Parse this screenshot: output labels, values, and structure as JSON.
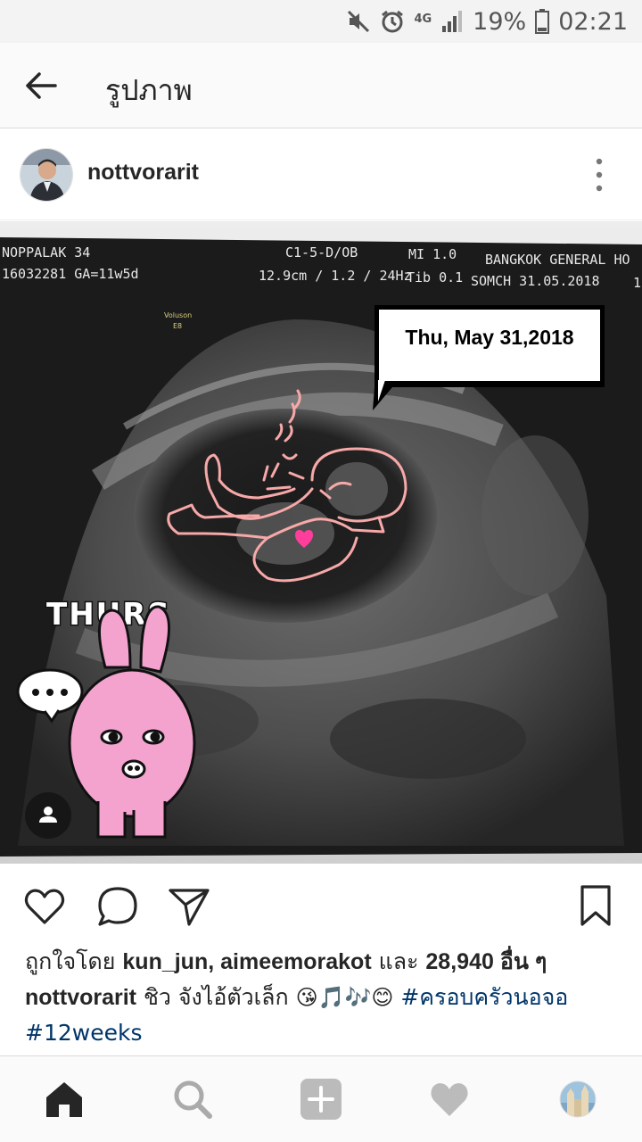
{
  "status_bar": {
    "network": "4G",
    "battery": "19%",
    "time": "02:21"
  },
  "app_bar": {
    "title": "รูปภาพ",
    "back_icon": "arrow-left-icon"
  },
  "post": {
    "username": "nottvorarit",
    "avatar_icon": "profile-avatar",
    "more_icon": "vertical-dots-icon"
  },
  "photo": {
    "header_left_1": "NOPPALAK 34",
    "header_left_2": "16032281 GA=11w5d",
    "header_mid_1": "C1-5-D/OB",
    "header_mid_2": "12.9cm / 1.2 / 24Hz",
    "header_mi_1": "MI 1.0",
    "header_mi_2": "Tib 0.1",
    "header_right_1": "BANGKOK GENERAL HO",
    "header_right_2": "SOMCH 31.05.2018",
    "header_edge": "1",
    "device_label_1": "Voluson",
    "device_label_2": "E8",
    "date_bubble": "Thu, May 31,2018",
    "sticker_text": "THURS",
    "tag_icon": "person-tag-icon"
  },
  "actions": {
    "like_icon": "heart-icon",
    "comment_icon": "comment-icon",
    "share_icon": "send-icon",
    "save_icon": "bookmark-icon"
  },
  "likes": {
    "prefix": "ถูกใจโดย ",
    "users": "kun_jun, aimeemorakot",
    "conj": " และ ",
    "count": "28,940",
    "suffix": " อื่น ๆ"
  },
  "caption": {
    "username": "nottvorarit",
    "text": " ชิว จังไอ้ตัวเล็ก ",
    "emoji": "😘🎵🎶😊",
    "hashtag1": "#ครอบครัวนอจอ",
    "hashtag2": "#12weeks"
  },
  "bottom_nav": {
    "home_icon": "home-icon",
    "search_icon": "search-icon",
    "add_icon": "add-post-icon",
    "activity_icon": "heart-icon",
    "profile_icon": "profile-avatar-icon"
  },
  "colors": {
    "hashtag": "#003569",
    "sticker_pink": "#f4a3cf",
    "outline_pink": "#f7a8a8"
  }
}
